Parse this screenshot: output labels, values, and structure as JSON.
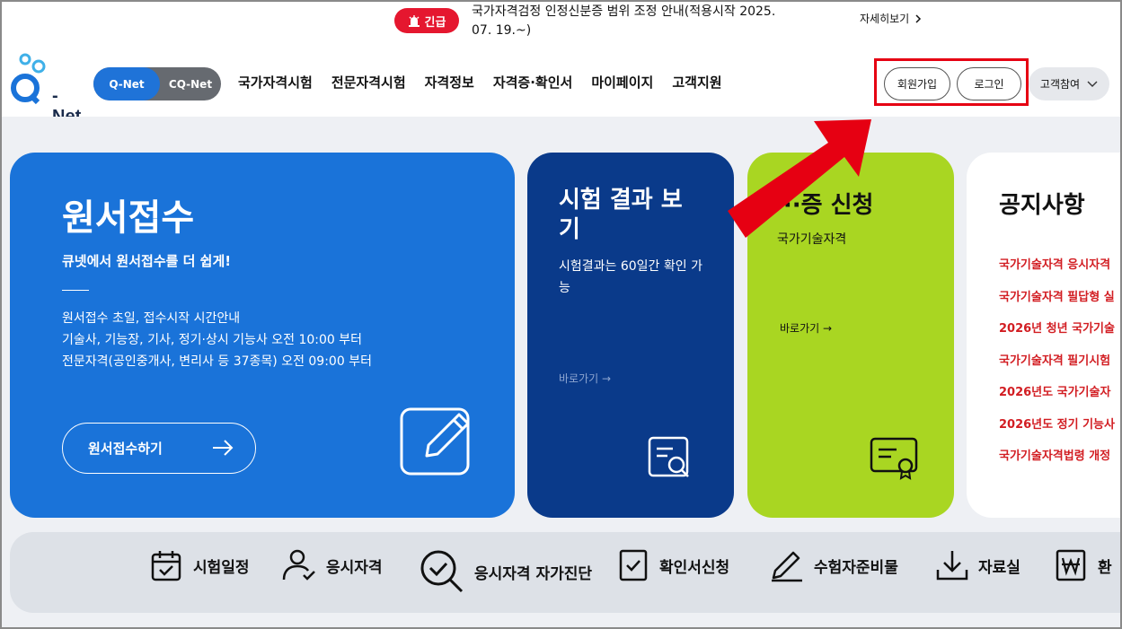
{
  "alert": {
    "badge": "긴급",
    "text": "국가자격검정 인정신분증 범위 조정 안내(적용시작 2025. 07. 19.~)",
    "more": "자세히보기"
  },
  "header": {
    "logo_text": "- Net",
    "toggle": {
      "active": "Q-Net",
      "inactive": "CQ-Net"
    },
    "nav": [
      "국가자격시험",
      "전문자격시험",
      "자격정보",
      "자격증·확인서",
      "마이페이지",
      "고객지원"
    ],
    "join": "회원가입",
    "login": "로그인",
    "customer": "고객참여"
  },
  "cards": {
    "apply": {
      "title": "원서접수",
      "subtitle": "큐넷에서 원서접수를 더 쉽게!",
      "info": [
        "원서접수 초일, 접수시작 시간안내",
        "기술사, 기능장, 기사, 정기·상시 기능사 오전 10:00 부터",
        "전문자격(공인중개사, 변리사 등 37종목) 오전 09:00 부터"
      ],
      "button": "원서접수하기"
    },
    "result": {
      "title": "시험 결과 보기",
      "desc": "시험결과는 60일간 확인 가능",
      "link": "바로가기 →"
    },
    "green": {
      "title": "···증 신청",
      "sub": "국가기술자격",
      "link": "바로가기 →"
    },
    "notice": {
      "title": "공지사항",
      "items": [
        "국가기술자격 응시자격",
        "국가기술자격 필답형 실",
        "2026년 청년 국가기술",
        "국가기술자격 필기시험",
        "2026년도 국가기술자",
        "2026년도 정기 기능사",
        "국가기술자격법령 개정"
      ]
    }
  },
  "quick": [
    "시험일정",
    "응시자격",
    "응시자격 자가진단",
    "확인서신청",
    "수험자준비물",
    "자료실",
    "환"
  ],
  "colors": {
    "primary": "#1a73d9",
    "navy": "#0a3a8a",
    "lime": "#a9d622",
    "alert": "#e5172f"
  }
}
